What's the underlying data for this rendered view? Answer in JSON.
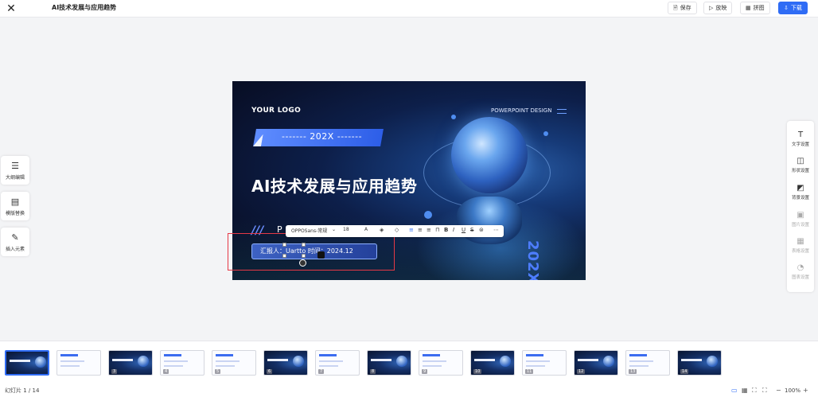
{
  "header": {
    "title": "AI技术发展与应用趋势",
    "buttons": {
      "save": "保存",
      "play": "放映",
      "puzzle": "拼图",
      "download": "下载"
    }
  },
  "left_tools": [
    "大纲编辑",
    "模版替换",
    "插入元素"
  ],
  "right_panel": [
    "文字设置",
    "形状设置",
    "背景设置",
    "图片设置",
    "表格设置",
    "图表设置"
  ],
  "slide": {
    "logo": "YOUR LOGO",
    "design_label": "POWERPOINT DESIGN",
    "year_banner": "------- 202X -------",
    "title": "AI技术发展与应用趋势",
    "p_letter": "P",
    "reporter": "汇报人：Uartto  时间：2024.12",
    "vertical_year": "202X"
  },
  "text_toolbar": {
    "font": "OPPOSans-常规",
    "size": "18",
    "color_a": "A"
  },
  "thumbnails": {
    "count": 14,
    "selected": 1,
    "labels": [
      "1",
      "2",
      "3",
      "4",
      "5",
      "6",
      "7",
      "8",
      "9",
      "10",
      "11",
      "12",
      "13",
      "14"
    ]
  },
  "footer": {
    "counter": "幻灯片 1 / 14",
    "zoom": "100%"
  }
}
